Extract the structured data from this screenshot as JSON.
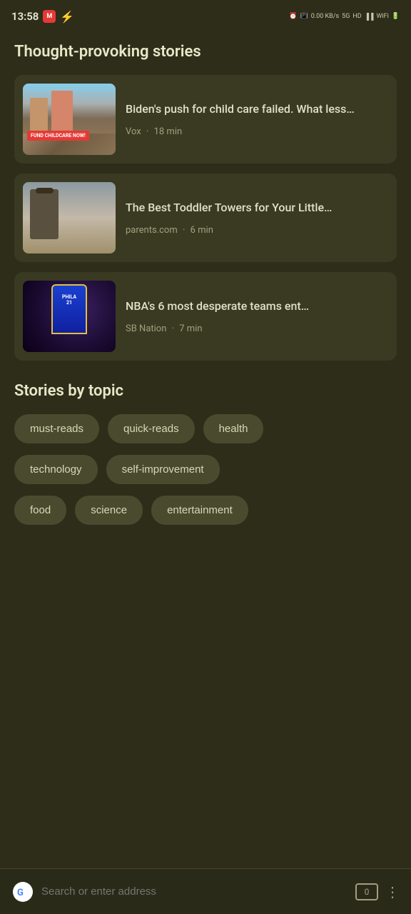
{
  "statusBar": {
    "time": "13:58",
    "leftIcons": [
      "app-icon",
      "flash-icon"
    ],
    "rightText": "0.00 KB/s"
  },
  "thoughtSection": {
    "title": "Thought-provoking stories",
    "stories": [
      {
        "id": "story-1",
        "title": "Biden's push for child care failed. What less…",
        "source": "Vox",
        "readTime": "18 min",
        "thumbType": "childcare"
      },
      {
        "id": "story-2",
        "title": "The Best Toddler Towers for Your Little…",
        "source": "parents.com",
        "readTime": "6 min",
        "thumbType": "toddler"
      },
      {
        "id": "story-3",
        "title": "NBA's 6 most desperate teams ent…",
        "source": "SB Nation",
        "readTime": "7 min",
        "thumbType": "nba"
      }
    ]
  },
  "topicsSection": {
    "title": "Stories by topic",
    "topics": [
      {
        "id": "must-reads",
        "label": "must-reads"
      },
      {
        "id": "quick-reads",
        "label": "quick-reads"
      },
      {
        "id": "health",
        "label": "health"
      },
      {
        "id": "technology",
        "label": "technology"
      },
      {
        "id": "self-improvement",
        "label": "self-improvement"
      },
      {
        "id": "food",
        "label": "food"
      },
      {
        "id": "science",
        "label": "science"
      },
      {
        "id": "entertainment",
        "label": "entertainment"
      }
    ]
  },
  "browserBar": {
    "searchPlaceholder": "Search or enter address",
    "tabsCount": "0"
  },
  "dots": "⋮"
}
